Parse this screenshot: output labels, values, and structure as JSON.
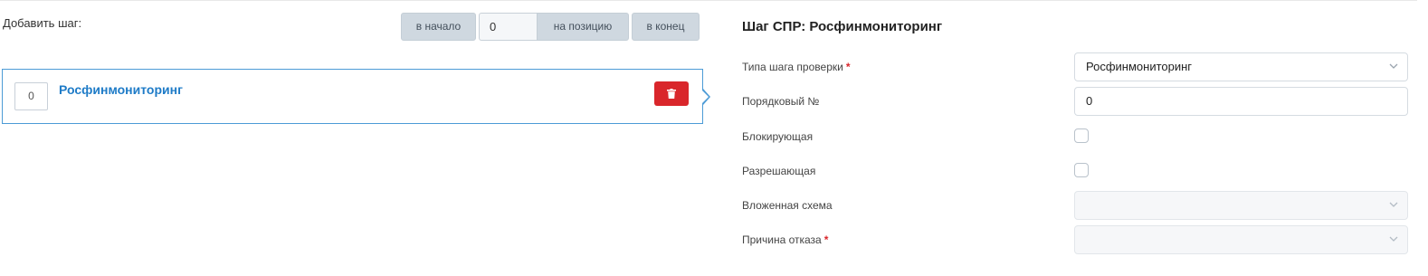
{
  "left": {
    "add_step_label": "Добавить шаг:",
    "btn_start": "в начало",
    "position_value": "0",
    "btn_position": "на позицию",
    "btn_end": "в конец",
    "step": {
      "number": "0",
      "title": "Росфинмониторинг"
    }
  },
  "form": {
    "title": "Шаг СПР: Росфинмониторинг",
    "step_type": {
      "label": "Типа шага проверки",
      "required": "*",
      "value": "Росфинмониторинг"
    },
    "order": {
      "label": "Порядковый №",
      "value": "0"
    },
    "blocking": {
      "label": "Блокирующая",
      "checked": false
    },
    "allowing": {
      "label": "Разрешающая",
      "checked": false
    },
    "nested_scheme": {
      "label": "Вложенная схема",
      "value": ""
    },
    "reject_reason": {
      "label": "Причина отказа",
      "required": "*",
      "value": ""
    }
  },
  "colors": {
    "accent": "#1e7bc7",
    "border_active": "#4c9bd6",
    "danger": "#d9262b",
    "button_gray": "#cfd8e0"
  },
  "icons": {
    "delete": "trash-icon",
    "dropdown": "chevron-down-icon"
  }
}
